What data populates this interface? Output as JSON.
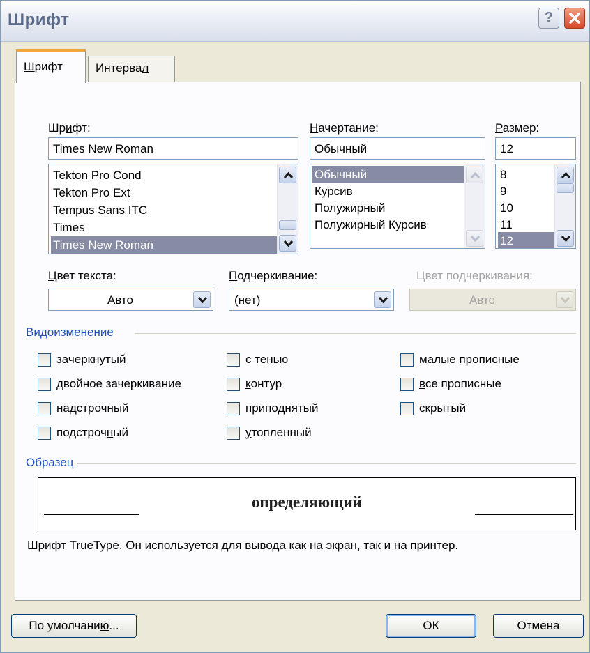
{
  "window": {
    "title": "Шрифт"
  },
  "tabs": [
    {
      "pre": "",
      "ul": "Ш",
      "post": "рифт"
    },
    {
      "pre": "Интерва",
      "ul": "л",
      "post": ""
    }
  ],
  "font": {
    "label": {
      "pre": "Шр",
      "ul": "и",
      "post": "фт:"
    },
    "value": "Times New Roman",
    "items": [
      "Tekton Pro Cond",
      "Tekton Pro Ext",
      "Tempus Sans ITC",
      "Times",
      "Times New Roman"
    ]
  },
  "style": {
    "label": {
      "pre": "",
      "ul": "Н",
      "post": "ачертание:"
    },
    "value": "Обычный",
    "items": [
      "Обычный",
      "Курсив",
      "Полужирный",
      "Полужирный Курсив"
    ]
  },
  "size": {
    "label": {
      "pre": "",
      "ul": "Р",
      "post": "азмер:"
    },
    "value": "12",
    "items": [
      "8",
      "9",
      "10",
      "11",
      "12"
    ]
  },
  "text_color": {
    "label": {
      "pre": "",
      "ul": "Ц",
      "post": "вет текста:"
    },
    "value": "Авто"
  },
  "underline": {
    "label": {
      "pre": "",
      "ul": "П",
      "post": "одчеркивание:"
    },
    "value": "(нет)"
  },
  "underline_color": {
    "label": "Цвет подчеркивания:",
    "value": "Авто"
  },
  "effects": {
    "title": "Видоизменение",
    "items": [
      {
        "pre": "",
        "ul": "з",
        "post": "ачеркнутый",
        "checked": false
      },
      {
        "pre": "",
        "ul": "д",
        "post": "войное зачеркивание",
        "checked": false
      },
      {
        "pre": "над",
        "ul": "с",
        "post": "трочный",
        "checked": false
      },
      {
        "pre": "подстроч",
        "ul": "н",
        "post": "ый",
        "checked": false
      },
      {
        "pre": "с тен",
        "ul": "ь",
        "post": "ю",
        "checked": false
      },
      {
        "pre": "",
        "ul": "к",
        "post": "онтур",
        "checked": false
      },
      {
        "pre": "приподн",
        "ul": "я",
        "post": "тый",
        "checked": false
      },
      {
        "pre": "",
        "ul": "у",
        "post": "топленный",
        "checked": false
      },
      {
        "pre": "м",
        "ul": "а",
        "post": "лые прописные",
        "checked": false
      },
      {
        "pre": "",
        "ul": "в",
        "post": "се прописные",
        "checked": false
      },
      {
        "pre": "скрыт",
        "ul": "ы",
        "post": "й",
        "checked": false
      }
    ]
  },
  "preview": {
    "title": "Образец",
    "sample": "определяющий",
    "note": "Шрифт TrueType. Он используется для вывода как на экран, так и на принтер."
  },
  "buttons": {
    "default": {
      "pre": "По умолчани",
      "ul": "ю",
      "post": "..."
    },
    "ok": "ОК",
    "cancel": "Отмена"
  }
}
